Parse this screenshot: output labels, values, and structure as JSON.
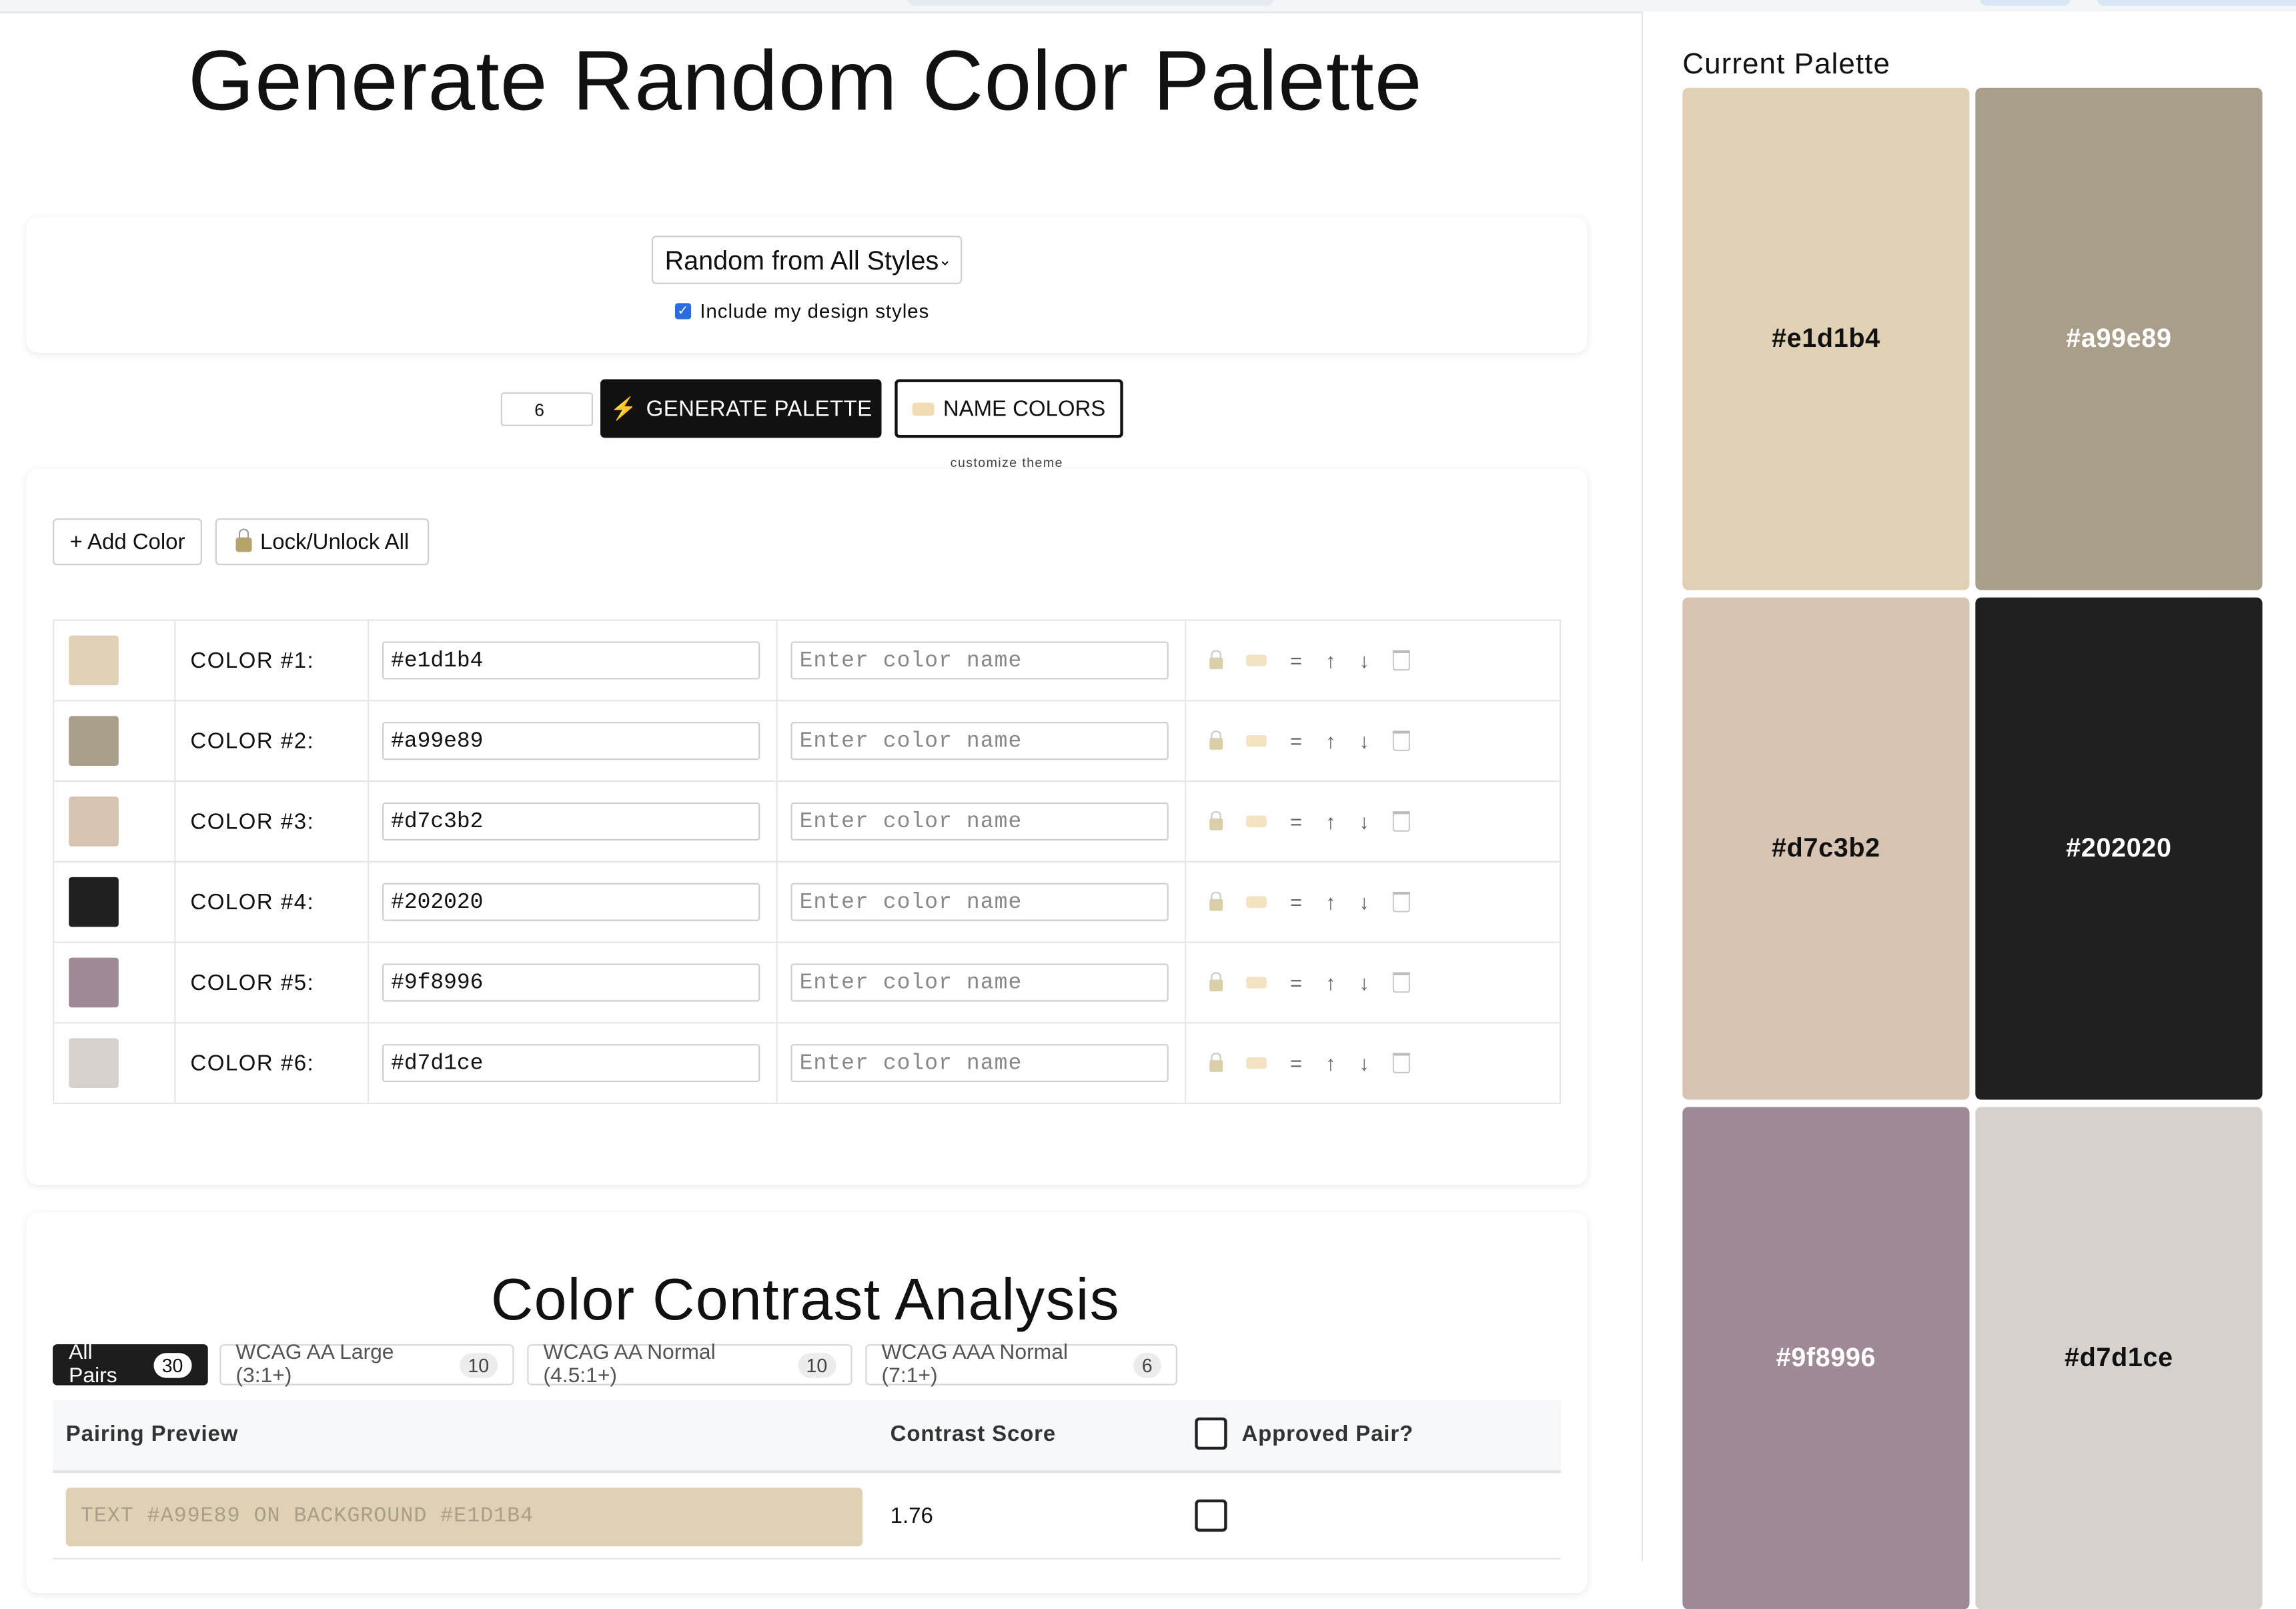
{
  "page": {
    "title": "Generate Random Color Palette"
  },
  "controls": {
    "style_select": "Random from All Styles",
    "include_label": "Include my design styles",
    "count": "6",
    "generate_label": "GENERATE PALETTE",
    "generate_icon": "⚡",
    "name_colors_label": "NAME COLORS",
    "customize_label": "customize theme"
  },
  "editor": {
    "add_label": "+ Add Color",
    "lock_all_label": "Lock/Unlock All",
    "placeholder": "Enter color name",
    "colors": [
      {
        "label": "COLOR #1:",
        "hex": "#e1d1b4"
      },
      {
        "label": "COLOR #2:",
        "hex": "#a99e89"
      },
      {
        "label": "COLOR #3:",
        "hex": "#d7c3b2"
      },
      {
        "label": "COLOR #4:",
        "hex": "#202020"
      },
      {
        "label": "COLOR #5:",
        "hex": "#9f8996"
      },
      {
        "label": "COLOR #6:",
        "hex": "#d7d1ce"
      }
    ],
    "action_glyphs": {
      "equals": "=",
      "up": "↑",
      "down": "↓"
    }
  },
  "contrast": {
    "title": "Color Contrast Analysis",
    "tabs": [
      {
        "label": "All Pairs",
        "count": "30"
      },
      {
        "label": "WCAG AA Large (3:1+)",
        "count": "10"
      },
      {
        "label": "WCAG AA Normal (4.5:1+)",
        "count": "10"
      },
      {
        "label": "WCAG AAA Normal (7:1+)",
        "count": "6"
      }
    ],
    "headers": {
      "preview": "Pairing Preview",
      "score": "Contrast Score",
      "approved": "Approved Pair?"
    },
    "rows": [
      {
        "preview": "TEXT #A99E89 ON BACKGROUND #E1D1B4",
        "score": "1.76"
      }
    ]
  },
  "sidebar": {
    "title": "Current Palette",
    "swatches": [
      {
        "hex": "#e1d1b4",
        "text_color": "#111111"
      },
      {
        "hex": "#a99e89",
        "text_color": "#ffffff"
      },
      {
        "hex": "#d7c3b2",
        "text_color": "#111111"
      },
      {
        "hex": "#202020",
        "text_color": "#ffffff"
      },
      {
        "hex": "#9f8996",
        "text_color": "#ffffff"
      },
      {
        "hex": "#d7d1ce",
        "text_color": "#111111"
      }
    ]
  }
}
